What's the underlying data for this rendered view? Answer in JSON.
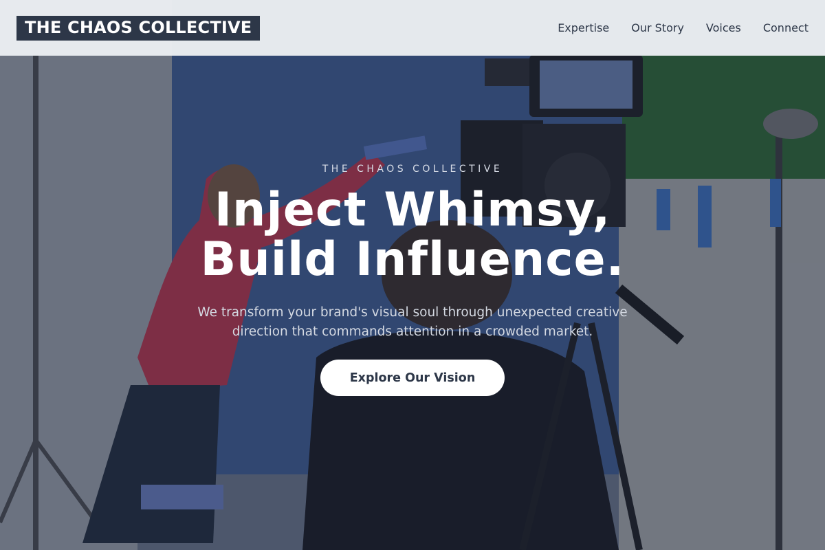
{
  "header": {
    "brand": "THE CHAOS COLLECTIVE",
    "nav": [
      "Expertise",
      "Our Story",
      "Voices",
      "Connect"
    ]
  },
  "hero": {
    "eyebrow": "THE CHAOS COLLECTIVE",
    "headline_line1": "Inject Whimsy,",
    "headline_line2": "Build Influence.",
    "subtext": "We transform your brand's visual soul through unexpected creative direction that commands attention in a crowded market.",
    "cta_label": "Explore Our Vision",
    "background_image": "film-set-photo"
  },
  "colors": {
    "header_bg": "#eceff2",
    "brand_bg": "#2d3748",
    "nav_text": "#2d3748",
    "cta_bg": "#ffffff",
    "cta_text": "#2d3748"
  }
}
